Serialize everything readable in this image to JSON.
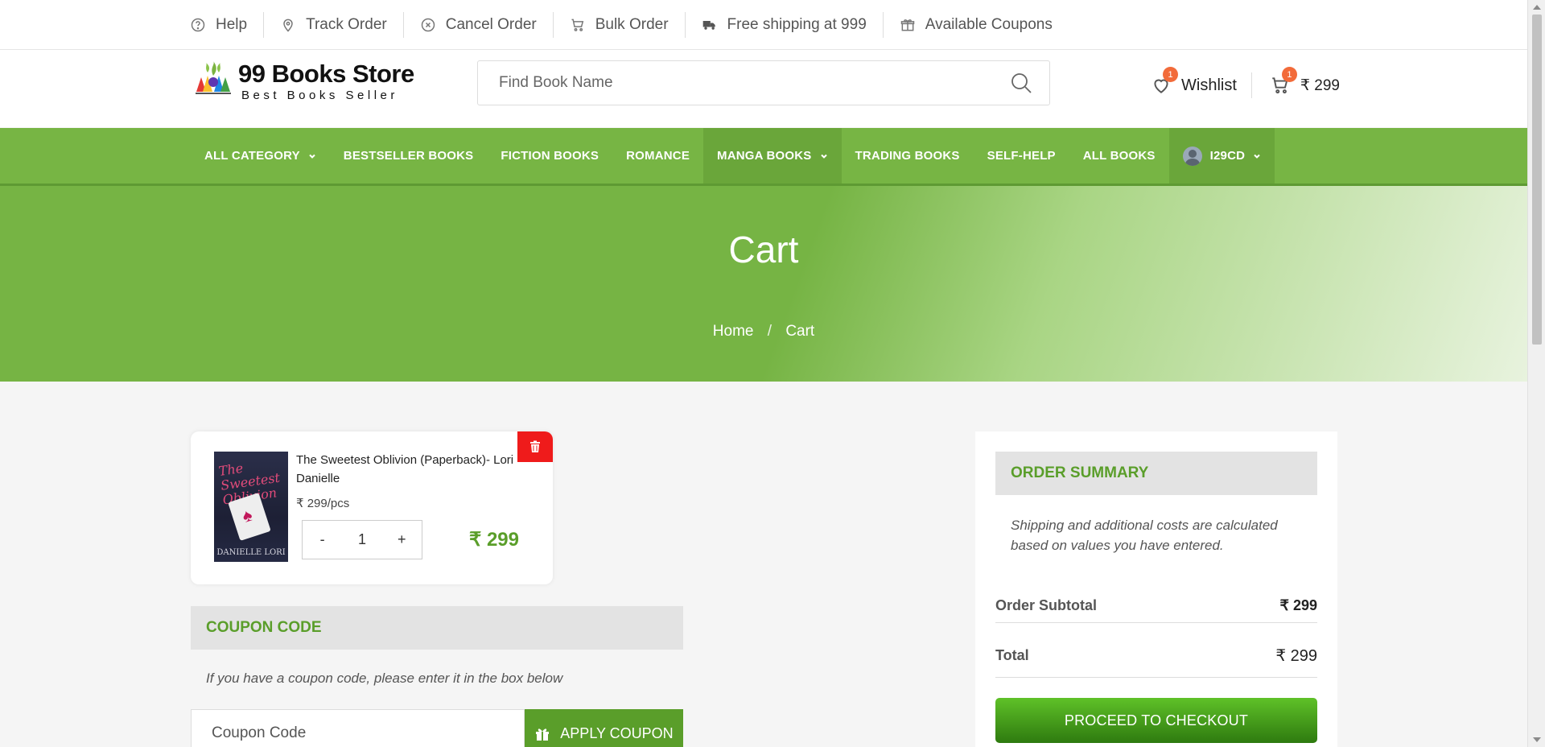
{
  "topbar": {
    "items": [
      {
        "label": "Help",
        "icon": "help-circle-icon"
      },
      {
        "label": "Track Order",
        "icon": "location-pin-icon"
      },
      {
        "label": "Cancel Order",
        "icon": "cancel-circle-icon"
      },
      {
        "label": "Bulk Order",
        "icon": "cart-icon"
      },
      {
        "label": "Free shipping at 999",
        "icon": "truck-icon"
      },
      {
        "label": "Available Coupons",
        "icon": "gift-icon"
      }
    ]
  },
  "header": {
    "logo_name": "99 Books Store",
    "logo_tagline": "Best Books Seller",
    "search_placeholder": "Find Book Name",
    "wishlist_label": "Wishlist",
    "wishlist_count": "1",
    "cart_count": "1",
    "cart_amount": "₹ 299"
  },
  "nav": {
    "items": [
      {
        "label": "ALL CATEGORY",
        "dropdown": true
      },
      {
        "label": "BESTSELLER BOOKS"
      },
      {
        "label": "FICTION BOOKS"
      },
      {
        "label": "ROMANCE"
      },
      {
        "label": "MANGA BOOKS",
        "dropdown": true
      },
      {
        "label": "TRADING BOOKS"
      },
      {
        "label": "SELF-HELP"
      },
      {
        "label": "ALL BOOKS"
      }
    ],
    "user_label": "I29CD"
  },
  "hero": {
    "title": "Cart",
    "breadcrumb": [
      "Home",
      "Cart"
    ],
    "breadcrumb_sep": "/"
  },
  "cart_item": {
    "name": "The Sweetest Oblivion (Paperback)- Lori Danielle",
    "unit_price": "₹ 299/pcs",
    "qty_minus": "-",
    "quantity": "1",
    "qty_plus": "+",
    "line_price": "₹ 299",
    "cover_title": "The Sweetest Oblivion",
    "cover_author": "DANIELLE LORI"
  },
  "coupon": {
    "heading": "COUPON CODE",
    "note": "If you have a coupon code, please enter it in the box below",
    "placeholder": "Coupon Code",
    "apply_label": "APPLY COUPON"
  },
  "summary": {
    "heading": "ORDER SUMMARY",
    "note": "Shipping and additional costs are calculated based on values you have entered.",
    "subtotal_label": "Order Subtotal",
    "subtotal_value": "₹ 299",
    "total_label": "Total",
    "total_value": "₹ 299",
    "checkout_label": "PROCEED TO CHECKOUT"
  },
  "colors": {
    "brand_green": "#77b544",
    "accent_green_text": "#5a9e2a",
    "delete_red": "#ef1b1b",
    "badge_orange": "#f26b3a"
  }
}
